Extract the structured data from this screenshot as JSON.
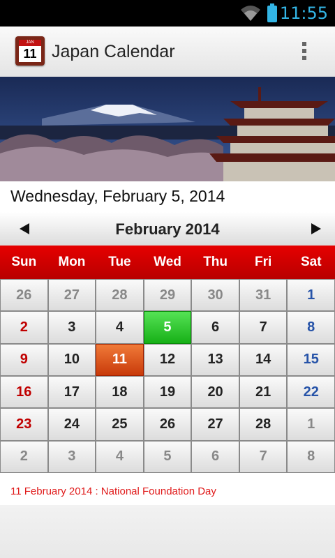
{
  "status": {
    "time": "11:55"
  },
  "app": {
    "title": "Japan Calendar",
    "icon_month": "JAN",
    "icon_day": "11"
  },
  "selected_date": "Wednesday, February 5, 2014",
  "calendar": {
    "month_label": "February  2014",
    "weekdays": [
      "Sun",
      "Mon",
      "Tue",
      "Wed",
      "Thu",
      "Fri",
      "Sat"
    ],
    "weeks": [
      [
        "26",
        "27",
        "28",
        "29",
        "30",
        "31",
        "1"
      ],
      [
        "2",
        "3",
        "4",
        "5",
        "6",
        "7",
        "8"
      ],
      [
        "9",
        "10",
        "11",
        "12",
        "13",
        "14",
        "15"
      ],
      [
        "16",
        "17",
        "18",
        "19",
        "20",
        "21",
        "22"
      ],
      [
        "23",
        "24",
        "25",
        "26",
        "27",
        "28",
        "1"
      ],
      [
        "2",
        "3",
        "4",
        "5",
        "6",
        "7",
        "8"
      ]
    ],
    "today": "5",
    "holiday": "11"
  },
  "holiday_note": "11 February 2014 : National Foundation Day",
  "colors": {
    "accent": "#33b5e5",
    "weekday_bar": "#d40000",
    "today": "#22c022",
    "holiday": "#e05a1e",
    "sunday": "#c00000",
    "saturday": "#2653a8"
  }
}
